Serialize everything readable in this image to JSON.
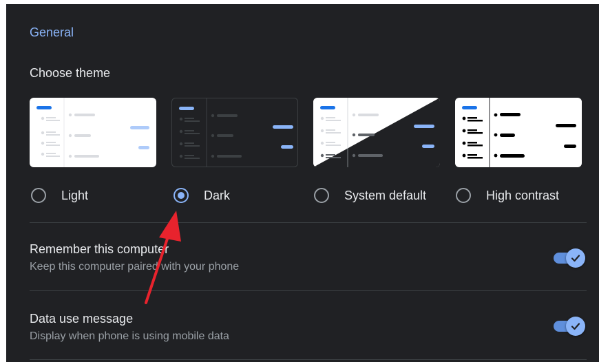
{
  "section": {
    "title": "General"
  },
  "theme": {
    "label": "Choose theme",
    "options": [
      {
        "label": "Light",
        "selected": false
      },
      {
        "label": "Dark",
        "selected": true
      },
      {
        "label": "System default",
        "selected": false
      },
      {
        "label": "High contrast",
        "selected": false
      }
    ]
  },
  "settings": [
    {
      "title": "Remember this computer",
      "description": "Keep this computer paired with your phone",
      "enabled": true
    },
    {
      "title": "Data use message",
      "description": "Display when phone is using mobile data",
      "enabled": true
    }
  ],
  "colors": {
    "background": "#202124",
    "accent": "#8ab4f8",
    "text_primary": "#e8eaed",
    "text_secondary": "#9aa0a6",
    "annotation_arrow": "#e8232d"
  },
  "icons": {
    "toggle_on": "check-icon",
    "annotation": "red-arrow-annotation"
  }
}
